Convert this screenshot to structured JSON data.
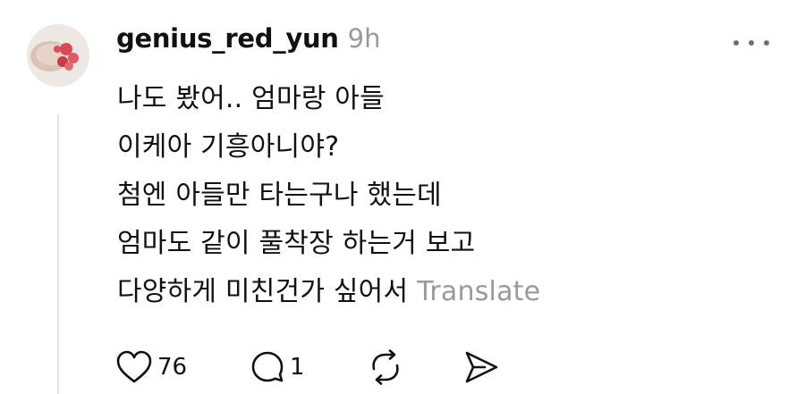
{
  "post": {
    "username": "genius_red_yun",
    "time": "9h",
    "lines": [
      "나도 봤어.. 엄마랑 아들",
      "이케아 기흥아니야?",
      "첨엔 아들만 타는구나 했는데",
      "엄마도 같이 풀착장 하는거 보고",
      "다양하게 미친건가 싶어서"
    ],
    "translate_label": "Translate"
  },
  "actions": {
    "likes": "76",
    "replies": "1"
  },
  "colors": {
    "text": "#111111",
    "muted": "#9a9a9a",
    "thread_line": "#e2e2e2"
  },
  "icons": [
    "avatar",
    "more-icon",
    "heart-icon",
    "comment-icon",
    "repost-icon",
    "share-icon"
  ]
}
